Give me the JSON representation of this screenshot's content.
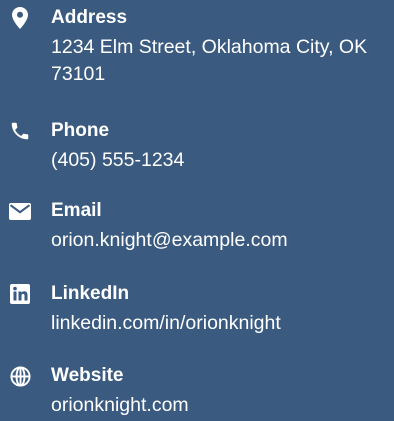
{
  "contacts": [
    {
      "icon": "map-pin-icon",
      "label": "Address",
      "value": "1234 Elm Street, Oklahoma City, OK 73101"
    },
    {
      "icon": "phone-icon",
      "label": "Phone",
      "value": "(405) 555-1234"
    },
    {
      "icon": "envelope-icon",
      "label": "Email",
      "value": "orion.knight@example.com"
    },
    {
      "icon": "linkedin-icon",
      "label": "LinkedIn",
      "value": "linkedin.com/in/orionknight"
    },
    {
      "icon": "globe-icon",
      "label": "Website",
      "value": "orionknight.com"
    }
  ],
  "colors": {
    "background": "#3a5a80",
    "text": "#ffffff"
  }
}
